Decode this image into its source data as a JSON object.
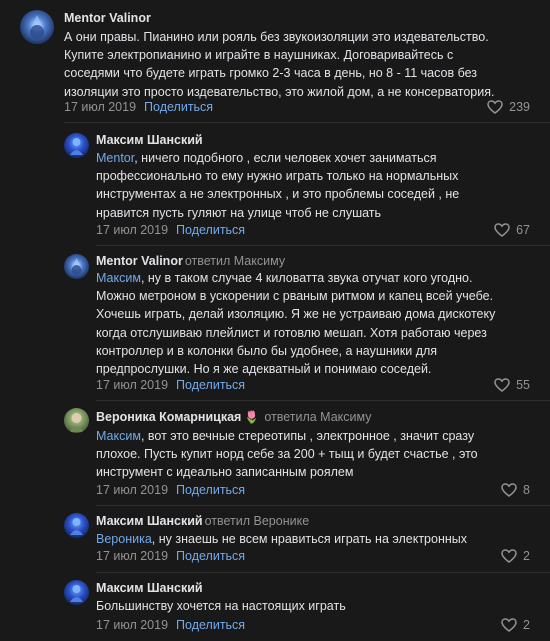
{
  "comments": [
    {
      "author": "Mentor Valinor",
      "replied_to": "",
      "mention": "",
      "lines": [
        "А они правы. Пианино или рояль без звукоизоляции это издевательство.",
        "Купите электропианино и играйте в наушниках. Договаривайтесь с",
        "соседями что будете играть громко 2-3 часа в день, но 8 - 11 часов без",
        "изоляции это просто издевательство, это жилой дом, а не консерватория."
      ],
      "date": "17 июл 2019",
      "share": "Поделиться",
      "likes": "239",
      "avatar_icon": "wizard-avatar"
    },
    {
      "author": "Максим Шанский",
      "replied_to": "",
      "mention": "Mentor",
      "lines": [
        ", ничего подобного , если человек хочет заниматься",
        "профессионально то ему нужно играть только на нормальных",
        "инструментах а не электронных , и это проблемы соседей , не",
        "нравится пусть гуляют на улице чтоб не слушать"
      ],
      "date": "17 июл 2019",
      "share": "Поделиться",
      "likes": "67",
      "avatar_icon": "blue-figure-avatar"
    },
    {
      "author": "Mentor Valinor",
      "replied_to": "ответил Максиму",
      "mention": "Максим",
      "lines": [
        ", ну в таком случае 4 киловатта звука отучат кого угодно.",
        "Можно метроном в ускорении с рваным ритмом и капец всей учебе.",
        "Хочешь играть, делай изоляцию. Я же не устраиваю дома дискотеку",
        "когда отслушиваю плейлист и готовлю мешап. Хотя работаю через",
        "контроллер и в колонки было бы удобнее, а наушники для",
        "предпрослушки. Но я же адекватный и понимаю соседей."
      ],
      "date": "17 июл 2019",
      "share": "Поделиться",
      "likes": "55",
      "avatar_icon": "wizard-avatar"
    },
    {
      "author": "Вероника Комарницкая",
      "replied_to": "ответила Максиму",
      "mention": "Максим",
      "lines": [
        ", вот это вечные стереотипы , электронное , значит сразу",
        "плохое. Пусть купит норд себе за 200 + тыщ и будет счастье , это",
        "инструмент с идеально записанным роялем"
      ],
      "date": "17 июл 2019",
      "share": "Поделиться",
      "likes": "8",
      "avatar_icon": "portrait-avatar",
      "badge_icon": "flower-icon"
    },
    {
      "author": "Максим Шанский",
      "replied_to": "ответил Веронике",
      "mention": "Вероника",
      "lines": [
        ", ну знаешь не всем нравиться играть на электронных"
      ],
      "date": "17 июл 2019",
      "share": "Поделиться",
      "likes": "2",
      "avatar_icon": "blue-figure-avatar"
    },
    {
      "author": "Максим Шанский",
      "replied_to": "",
      "mention": "",
      "lines": [
        "Большинству хочется на настоящих играть"
      ],
      "date": "17 июл 2019",
      "share": "Поделиться",
      "likes": "2",
      "avatar_icon": "blue-figure-avatar"
    }
  ],
  "colors": {
    "background": "#19191a",
    "text": "#e1e3e6",
    "secondary": "#939393",
    "link": "#71aaeb"
  }
}
